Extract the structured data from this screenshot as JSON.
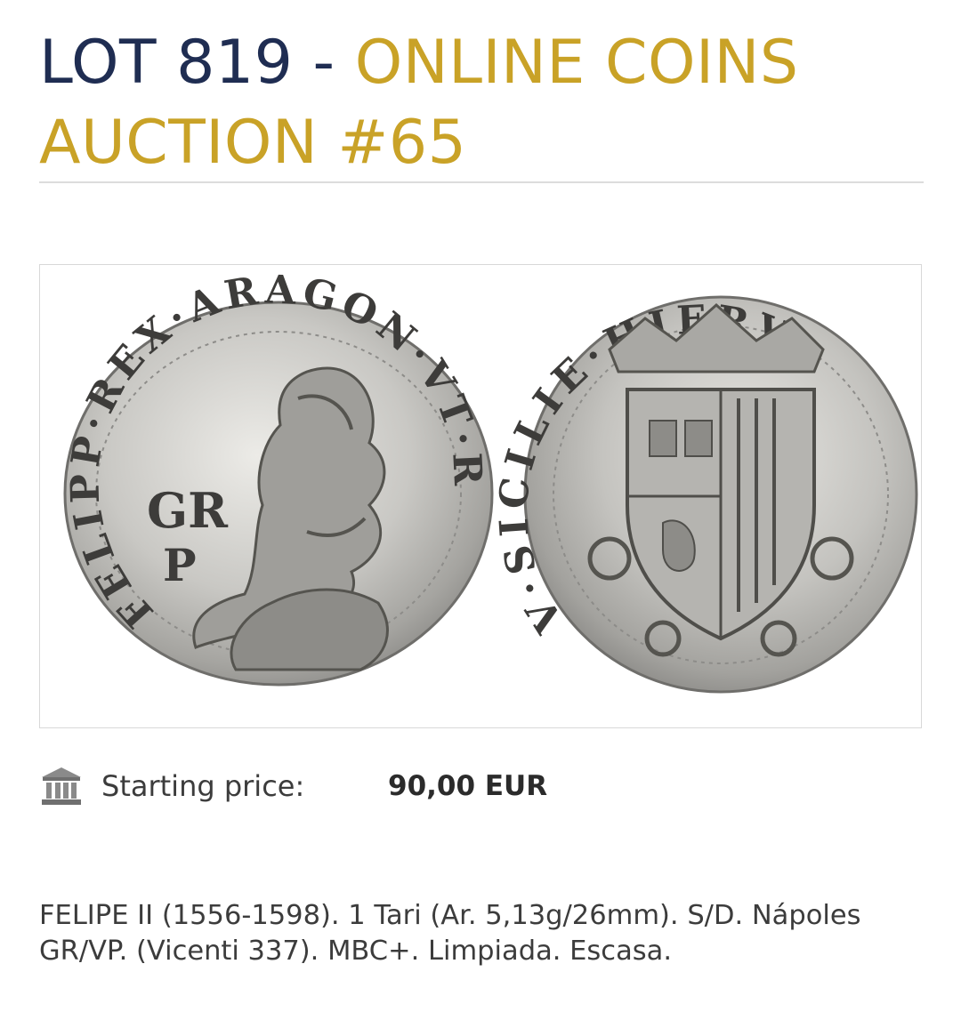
{
  "title": {
    "lot": "LOT 819",
    "separator": " - ",
    "auction": "ONLINE COINS AUCTION #65"
  },
  "images": {
    "obverse_legend": "FELIPP·REX·ARAGON·VT·R",
    "obverse_mark_1": "GR",
    "obverse_mark_2": "P",
    "reverse_legend": "V·SICILIE·HIERV"
  },
  "price": {
    "icon": "bank-icon",
    "label": "Starting price:",
    "value": "90,00 EUR"
  },
  "description": "FELIPE II (1556-1598). 1 Tari (Ar. 5,13g/26mm). S/D. Nápoles GR/VP. (Vicenti 337). MBC+. Limpiada. Escasa.",
  "colors": {
    "navy": "#1f2d52",
    "gold": "#c9a227",
    "silver": "#b9b9b7"
  }
}
